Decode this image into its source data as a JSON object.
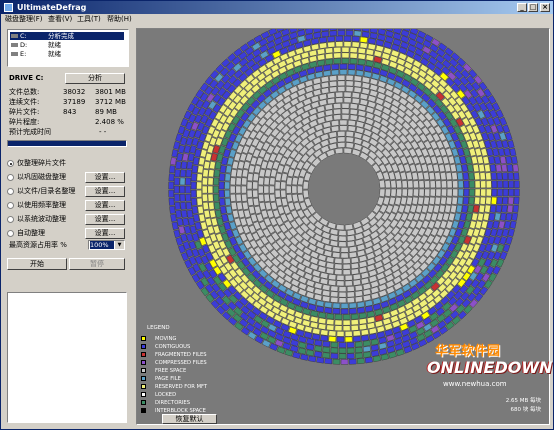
{
  "window": {
    "title": "UltimateDefrag"
  },
  "menu": [
    "磁盘整理(F)",
    "查看(V)",
    "工具(T)",
    "帮助(H)"
  ],
  "drives": [
    {
      "name": "C:",
      "status": "分析完成",
      "selected": true
    },
    {
      "name": "D:",
      "status": "就绪",
      "selected": false
    },
    {
      "name": "E:",
      "status": "就绪",
      "selected": false
    }
  ],
  "drive_label": "DRIVE C:",
  "analyze_button": "分析",
  "stats": [
    {
      "label": "文件总数:",
      "count": "38032",
      "size": "3801 MB"
    },
    {
      "label": "连续文件:",
      "count": "37189",
      "size": "3712 MB"
    },
    {
      "label": "碎片文件:",
      "count": "843",
      "size": "89 MB"
    }
  ],
  "fragmentation": {
    "label": "碎片程度:",
    "value": "2.408 %"
  },
  "eta": {
    "label": "预计完成时间",
    "value": "- -"
  },
  "progress": 1.0,
  "options": [
    {
      "label": "仅整理碎片文件",
      "selected": true,
      "has_settings": false
    },
    {
      "label": "以巩固磁盘整理",
      "selected": false,
      "has_settings": true
    },
    {
      "label": "以文件/目录名整理",
      "selected": false,
      "has_settings": true
    },
    {
      "label": "以使用频率整理",
      "selected": false,
      "has_settings": true
    },
    {
      "label": "以系统波动整理",
      "selected": false,
      "has_settings": true
    },
    {
      "label": "自动整理",
      "selected": false,
      "has_settings": true
    }
  ],
  "settings_label": "设置...",
  "usage": {
    "label": "最高资源占用率 %",
    "value": "100%"
  },
  "start_button": "开始",
  "pause_button": "暂停",
  "legend": {
    "title": "LEGEND",
    "items": [
      {
        "label": "MOVING",
        "color": "#ffff00"
      },
      {
        "label": "CONTIGUOUS",
        "color": "#3c3cd8"
      },
      {
        "label": "FRAGMENTED FILES",
        "color": "#c83232"
      },
      {
        "label": "COMPRESSED FILES",
        "color": "#8c50c8"
      },
      {
        "label": "FREE SPACE",
        "color": "#c8c8c8"
      },
      {
        "label": "PAGE FILE",
        "color": "#5aa0c8"
      },
      {
        "label": "RESERVED FOR MFT",
        "color": "#f0f07a"
      },
      {
        "label": "LOCKED",
        "color": "#ffffff"
      },
      {
        "label": "DIRECTORIES",
        "color": "#3c8c64"
      },
      {
        "label": "INTERBLOCK SPACE",
        "color": "#000000"
      }
    ]
  },
  "reset_zoom_button": "恢复默认",
  "map_stats": [
    "2.65 MB 每块",
    "680 块 每块"
  ],
  "watermark": {
    "cn": "华军软件园",
    "logo": "ONLINEDOWN",
    "url": "www.newhua.com"
  }
}
